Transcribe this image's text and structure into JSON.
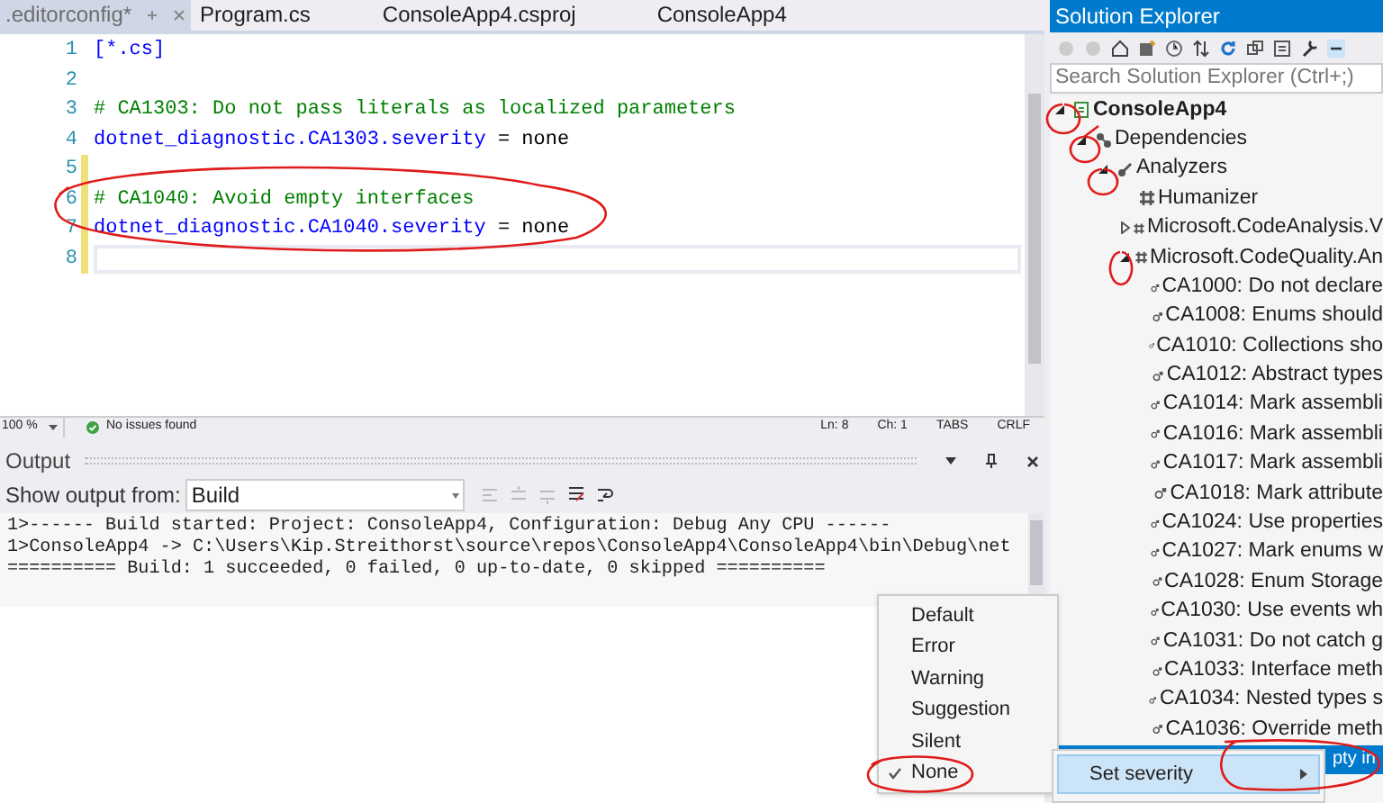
{
  "tabs": [
    {
      "label": ".editorconfig*",
      "selected": true
    },
    {
      "label": "Program.cs",
      "selected": false
    },
    {
      "label": "ConsoleApp4.csproj",
      "selected": false
    },
    {
      "label": "ConsoleApp4",
      "selected": false
    }
  ],
  "editor": {
    "lines": [
      {
        "number": "1",
        "changed": false,
        "current": false,
        "parts": [
          {
            "kind": "section",
            "text": "[*.cs]"
          }
        ]
      },
      {
        "number": "2",
        "changed": false,
        "current": false
      },
      {
        "number": "3",
        "changed": false,
        "current": false,
        "parts": [
          {
            "kind": "comment",
            "text": "# CA1303: Do not pass literals as localized parameters"
          }
        ]
      },
      {
        "number": "4",
        "changed": false,
        "current": false,
        "parts": [
          {
            "kind": "key",
            "text": "dotnet_diagnostic.CA1303.severity"
          },
          {
            "kind": "plain",
            "text": " = none"
          }
        ]
      },
      {
        "number": "5",
        "changed": true,
        "current": false
      },
      {
        "number": "6",
        "changed": true,
        "current": false,
        "parts": [
          {
            "kind": "comment",
            "text": "# CA1040: Avoid empty interfaces"
          }
        ]
      },
      {
        "number": "7",
        "changed": true,
        "current": false,
        "parts": [
          {
            "kind": "key",
            "text": "dotnet_diagnostic.CA1040.severity"
          },
          {
            "kind": "plain",
            "text": " = none"
          }
        ]
      },
      {
        "number": "8",
        "changed": true,
        "current": true
      }
    ]
  },
  "status_bar": {
    "zoom": "100 %",
    "issues": "No issues found",
    "line": "Ln: 8",
    "column": "Ch: 1",
    "indent": "TABS",
    "line_endings": "CRLF"
  },
  "output": {
    "title": "Output",
    "source_label": "Show output from:",
    "source": "Build",
    "lines": [
      "1>------ Build started: Project: ConsoleApp4, Configuration: Debug Any CPU ------",
      "1>ConsoleApp4 -> C:\\Users\\Kip.Streithorst\\source\\repos\\ConsoleApp4\\ConsoleApp4\\bin\\Debug\\net",
      "========== Build: 1 succeeded, 0 failed, 0 up-to-date, 0 skipped =========="
    ]
  },
  "solution_explorer": {
    "title": "Solution Explorer",
    "search_placeholder": "Search Solution Explorer (Ctrl+;)",
    "tree": [
      {
        "label": "ConsoleApp4",
        "kind": "project",
        "expanded": true,
        "selected": false,
        "children": [
          {
            "label": "Dependencies",
            "kind": "dependencies",
            "expanded": true,
            "selected": false,
            "children": [
              {
                "label": "Analyzers",
                "kind": "analyzers",
                "expanded": true,
                "selected": false,
                "children": [
                  {
                    "label": "Humanizer",
                    "kind": "package",
                    "selected": false
                  },
                  {
                    "label": "Microsoft.CodeAnalysis.V",
                    "kind": "package",
                    "expanded": false,
                    "selected": false
                  },
                  {
                    "label": "Microsoft.CodeQuality.An",
                    "kind": "package",
                    "expanded": true,
                    "selected": false,
                    "children": [
                      {
                        "label": "CA1000: Do not declare",
                        "kind": "rule",
                        "selected": false
                      },
                      {
                        "label": "CA1008: Enums should",
                        "kind": "rule",
                        "selected": false
                      },
                      {
                        "label": "CA1010: Collections sho",
                        "kind": "rule",
                        "selected": false
                      },
                      {
                        "label": "CA1012: Abstract types",
                        "kind": "rule",
                        "selected": false
                      },
                      {
                        "label": "CA1014: Mark assembli",
                        "kind": "rule",
                        "selected": false
                      },
                      {
                        "label": "CA1016: Mark assembli",
                        "kind": "rule",
                        "selected": false
                      },
                      {
                        "label": "CA1017: Mark assembli",
                        "kind": "rule",
                        "selected": false
                      },
                      {
                        "label": "CA1018: Mark attribute",
                        "kind": "rule",
                        "selected": false
                      },
                      {
                        "label": "CA1024: Use properties",
                        "kind": "rule",
                        "selected": false
                      },
                      {
                        "label": "CA1027: Mark enums w",
                        "kind": "rule",
                        "selected": false
                      },
                      {
                        "label": "CA1028: Enum Storage",
                        "kind": "rule",
                        "selected": false
                      },
                      {
                        "label": "CA1030: Use events wh",
                        "kind": "rule",
                        "selected": false
                      },
                      {
                        "label": "CA1031: Do not catch g",
                        "kind": "rule",
                        "selected": false
                      },
                      {
                        "label": "CA1033: Interface meth",
                        "kind": "rule",
                        "selected": false
                      },
                      {
                        "label": "CA1034: Nested types s",
                        "kind": "rule",
                        "selected": false
                      },
                      {
                        "label": "CA1036: Override meth",
                        "kind": "rule",
                        "selected": false
                      },
                      {
                        "label": "pty in",
                        "kind": "rule",
                        "selected": true
                      }
                    ]
                  }
                ]
              }
            ]
          }
        ]
      }
    ]
  },
  "context_menu": {
    "item": "Set severity",
    "submenu": [
      {
        "label": "Default",
        "checked": false
      },
      {
        "label": "Error",
        "checked": false
      },
      {
        "label": "Warning",
        "checked": false
      },
      {
        "label": "Suggestion",
        "checked": false
      },
      {
        "label": "Silent",
        "checked": false
      },
      {
        "label": "None",
        "checked": true
      }
    ]
  }
}
